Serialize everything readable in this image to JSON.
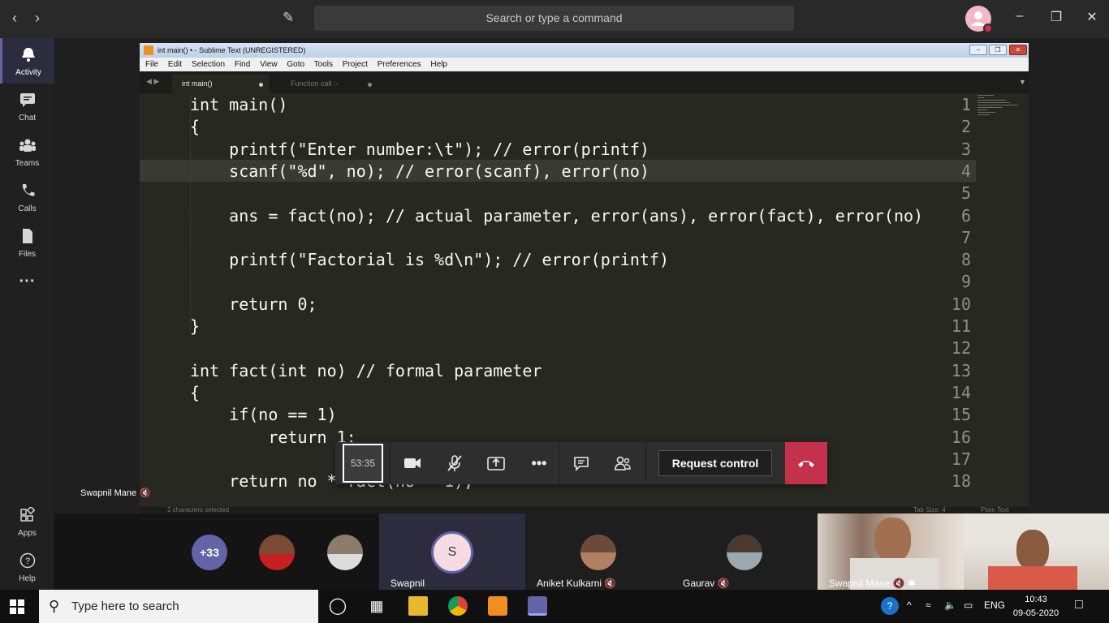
{
  "teams": {
    "search_placeholder": "Search or type a command",
    "rail": [
      {
        "label": "Activity"
      },
      {
        "label": "Chat"
      },
      {
        "label": "Teams"
      },
      {
        "label": "Calls"
      },
      {
        "label": "Files"
      },
      {
        "label": "..."
      },
      {
        "label": "Apps"
      },
      {
        "label": "Help"
      }
    ]
  },
  "sublime": {
    "title": "int main() • - Sublime Text (UNREGISTERED)",
    "menu": [
      "File",
      "Edit",
      "Selection",
      "Find",
      "View",
      "Goto",
      "Tools",
      "Project",
      "Preferences",
      "Help"
    ],
    "tabs": [
      {
        "label": "int main()"
      },
      {
        "label": "Function call :-"
      }
    ],
    "lines": [
      {
        "n": "1",
        "code": "int main()"
      },
      {
        "n": "2",
        "code": "{"
      },
      {
        "n": "3",
        "code": "    printf(\"Enter number:\\t\"); // error(printf)"
      },
      {
        "n": "4",
        "code": "    scanf(\"%d\", no); // error(scanf), error(no)"
      },
      {
        "n": "5",
        "code": ""
      },
      {
        "n": "6",
        "code": "    ans = fact(no); // actual parameter, error(ans), error(fact), error(no)"
      },
      {
        "n": "7",
        "code": ""
      },
      {
        "n": "8",
        "code": "    printf(\"Factorial is %d\\n\"); // error(printf)"
      },
      {
        "n": "9",
        "code": ""
      },
      {
        "n": "10",
        "code": "    return 0;"
      },
      {
        "n": "11",
        "code": "}"
      },
      {
        "n": "12",
        "code": ""
      },
      {
        "n": "13",
        "code": "int fact(int no) // formal parameter"
      },
      {
        "n": "14",
        "code": "{"
      },
      {
        "n": "15",
        "code": "    if(no == 1)"
      },
      {
        "n": "16",
        "code": "        return 1;"
      },
      {
        "n": "17",
        "code": ""
      },
      {
        "n": "18",
        "code": "    return no * fact(no - 1);"
      }
    ],
    "status_left": "2 characters selected",
    "status_tab": "Tab Size: 4",
    "status_syntax": "Plain Text"
  },
  "presenter": {
    "name": "Swapnil Mane"
  },
  "call": {
    "timer": "53:35",
    "request_control": "Request control"
  },
  "participants": {
    "overflow": "+33",
    "tiles": [
      {
        "name": "Swapnil",
        "initial": "S"
      },
      {
        "name": "Aniket Kulkarni"
      },
      {
        "name": "Gaurav"
      },
      {
        "name": "Swapnil Mane"
      }
    ]
  },
  "taskbar": {
    "search_placeholder": "Type here to search",
    "language": "ENG",
    "time": "10:43",
    "date": "09-05-2020"
  },
  "colors": {
    "teams_accent": "#6264a7",
    "hangup": "#c4314b",
    "editor_bg": "#272822"
  }
}
